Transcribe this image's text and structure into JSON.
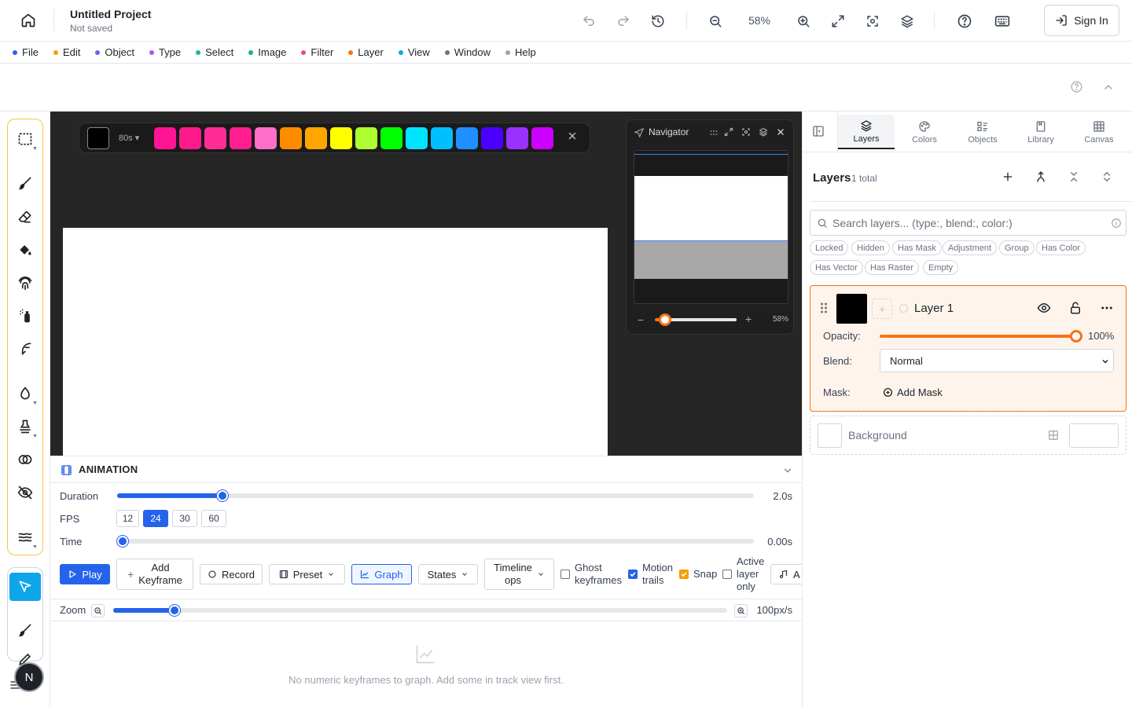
{
  "header": {
    "project_title": "Untitled Project",
    "project_status": "Not saved",
    "zoom": "58%",
    "sign_in": "Sign In"
  },
  "menu": [
    {
      "label": "File",
      "color": "#2563eb"
    },
    {
      "label": "Edit",
      "color": "#f59e0b"
    },
    {
      "label": "Object",
      "color": "#6366f1"
    },
    {
      "label": "Type",
      "color": "#a855f7"
    },
    {
      "label": "Select",
      "color": "#14b8a6"
    },
    {
      "label": "Image",
      "color": "#10b981"
    },
    {
      "label": "Filter",
      "color": "#ec4899"
    },
    {
      "label": "Layer",
      "color": "#f97316"
    },
    {
      "label": "View",
      "color": "#0ea5e9"
    },
    {
      "label": "Window",
      "color": "#64748b"
    },
    {
      "label": "Help",
      "color": "#9ca3af"
    }
  ],
  "swatches": {
    "current": "#000000",
    "size_label": "80s",
    "colors": [
      "#ff1493",
      "#ff1a8c",
      "#ff2d95",
      "#ff1f8f",
      "#ff6ec7",
      "#ff8c00",
      "#ffa500",
      "#ffff00",
      "#adff2f",
      "#00ff00",
      "#00e5ff",
      "#00bfff",
      "#1e90ff",
      "#4b00ff",
      "#9932ff",
      "#cc00ff"
    ]
  },
  "navigator": {
    "title": "Navigator",
    "zoom": "58%"
  },
  "animation": {
    "title": "ANIMATION",
    "duration_label": "Duration",
    "duration_value": "2.0s",
    "duration_fraction": 0.165,
    "fps_label": "FPS",
    "fps_options": [
      "12",
      "24",
      "30",
      "60"
    ],
    "fps_selected": "24",
    "time_label": "Time",
    "time_value": "0.00s",
    "buttons": {
      "play": "Play",
      "add_keyframe_1": "Add",
      "add_keyframe_2": "Keyframe",
      "record": "Record",
      "preset": "Preset",
      "graph": "Graph",
      "states": "States",
      "timeline_ops_1": "Timeline",
      "timeline_ops_2": "ops",
      "audio": "A"
    },
    "checks": {
      "ghost_1": "Ghost",
      "ghost_2": "keyframes",
      "motion_1": "Motion",
      "motion_2": "trails",
      "snap": "Snap",
      "active_1": "Active",
      "active_2": "layer",
      "active_3": "only"
    },
    "zoom_label": "Zoom",
    "zoom_value": "100px/s",
    "zoom_fraction": 0.1,
    "empty_message": "No numeric keyframes to graph. Add some in track view first."
  },
  "right_panel": {
    "tabs": [
      "Layers",
      "Colors",
      "Objects",
      "Library",
      "Canvas"
    ],
    "active_tab": "Layers",
    "layers_title": "Layers",
    "layers_count": "1 total",
    "search_placeholder": "Search layers... (type:, blend:, color:)",
    "chips": [
      "Locked",
      "Hidden",
      "Has Mask",
      "Adjustment",
      "Group",
      "Has Color",
      "Has Vector",
      "Has Raster",
      "Empty"
    ],
    "layer": {
      "name": "Layer 1",
      "opacity_label": "Opacity:",
      "opacity_value": "100%",
      "opacity_fraction": 1.0,
      "blend_label": "Blend:",
      "blend_value": "Normal",
      "mask_label": "Mask:",
      "add_mask": "Add Mask",
      "accent": "#f97316"
    },
    "background_layer": "Background"
  },
  "user": {
    "avatar_initial": "N"
  }
}
